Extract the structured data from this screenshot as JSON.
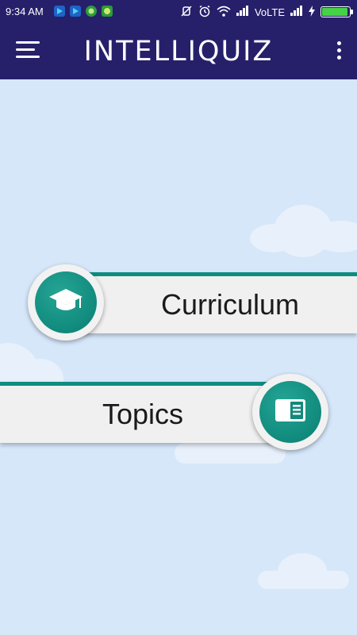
{
  "status_bar": {
    "time": "9:34 AM",
    "network_label": "VoLTE",
    "battery_level_percent": 95,
    "notification_icons": [
      "play-store-icon",
      "play-store-icon",
      "green-app-icon",
      "green-app-icon"
    ],
    "system_icons": [
      "mute-icon",
      "alarm-icon",
      "wifi-icon",
      "signal-icon",
      "signal-icon",
      "charging-icon"
    ]
  },
  "app_bar": {
    "title": "INTELLIQUIZ",
    "menu_icon": "hamburger-menu-icon",
    "overflow_icon": "more-vertical-icon"
  },
  "main": {
    "curriculum": {
      "label": "Curriculum",
      "icon": "graduation-cap-icon"
    },
    "topics": {
      "label": "Topics",
      "icon": "book-icon"
    }
  },
  "colors": {
    "header": "#26206b",
    "background": "#d6e7fa",
    "accent_teal": "#0f8c80",
    "card": "#f0f0f0"
  }
}
